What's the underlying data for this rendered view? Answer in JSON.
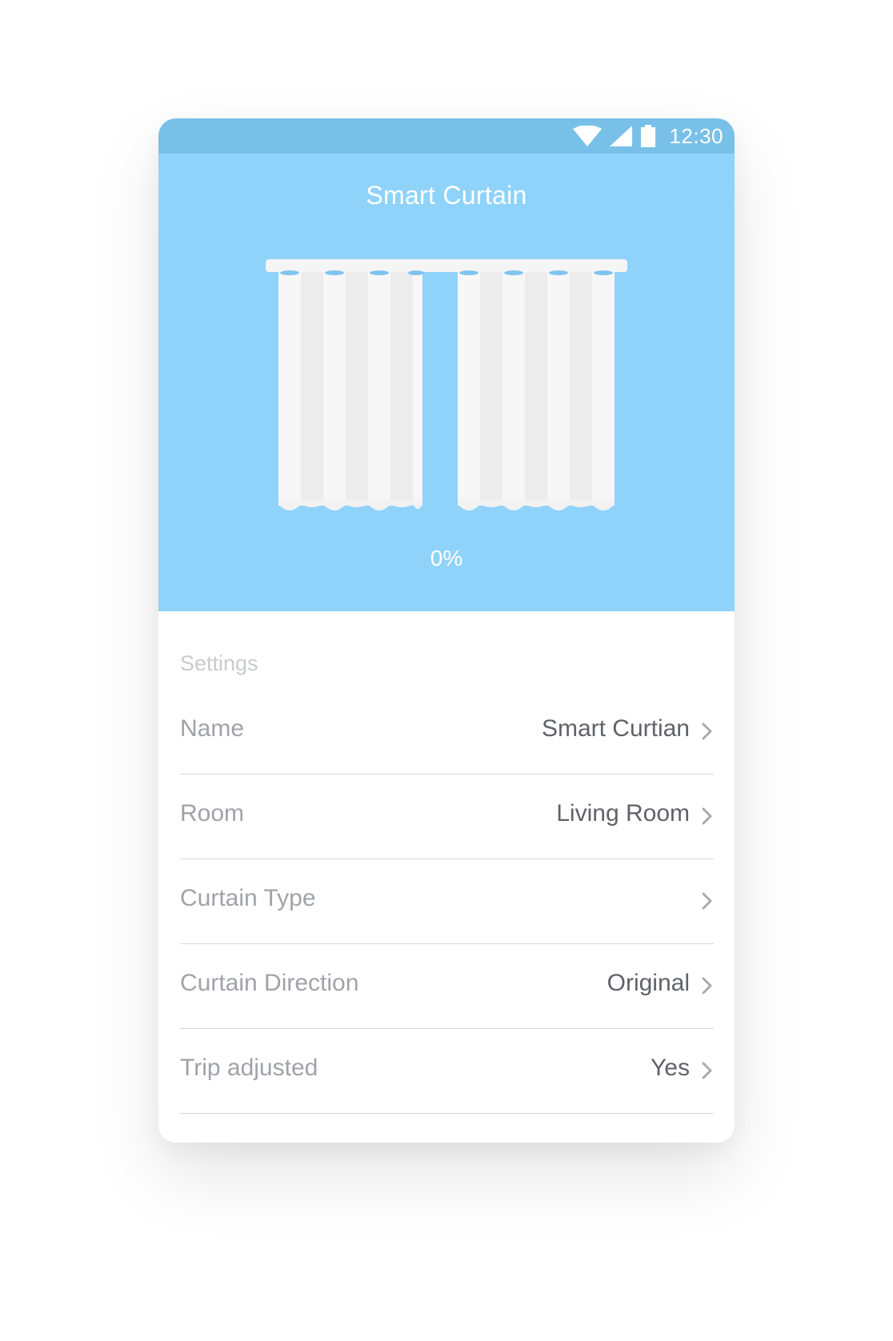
{
  "status_bar": {
    "time": "12:30",
    "background": "#79c0e9",
    "icons": [
      "wifi-icon",
      "cellular-signal-icon",
      "battery-icon"
    ]
  },
  "hero": {
    "title": "Smart Curtain",
    "background": "#8fd3fa",
    "percent": "0%",
    "open_fraction": 0
  },
  "settings": {
    "header": "Settings",
    "rows": [
      {
        "label": "Name",
        "value": "Smart Curtian"
      },
      {
        "label": "Room",
        "value": "Living Room"
      },
      {
        "label": "Curtain Type",
        "value": ""
      },
      {
        "label": "Curtain Direction",
        "value": "Original"
      },
      {
        "label": "Trip adjusted",
        "value": "Yes"
      }
    ]
  }
}
